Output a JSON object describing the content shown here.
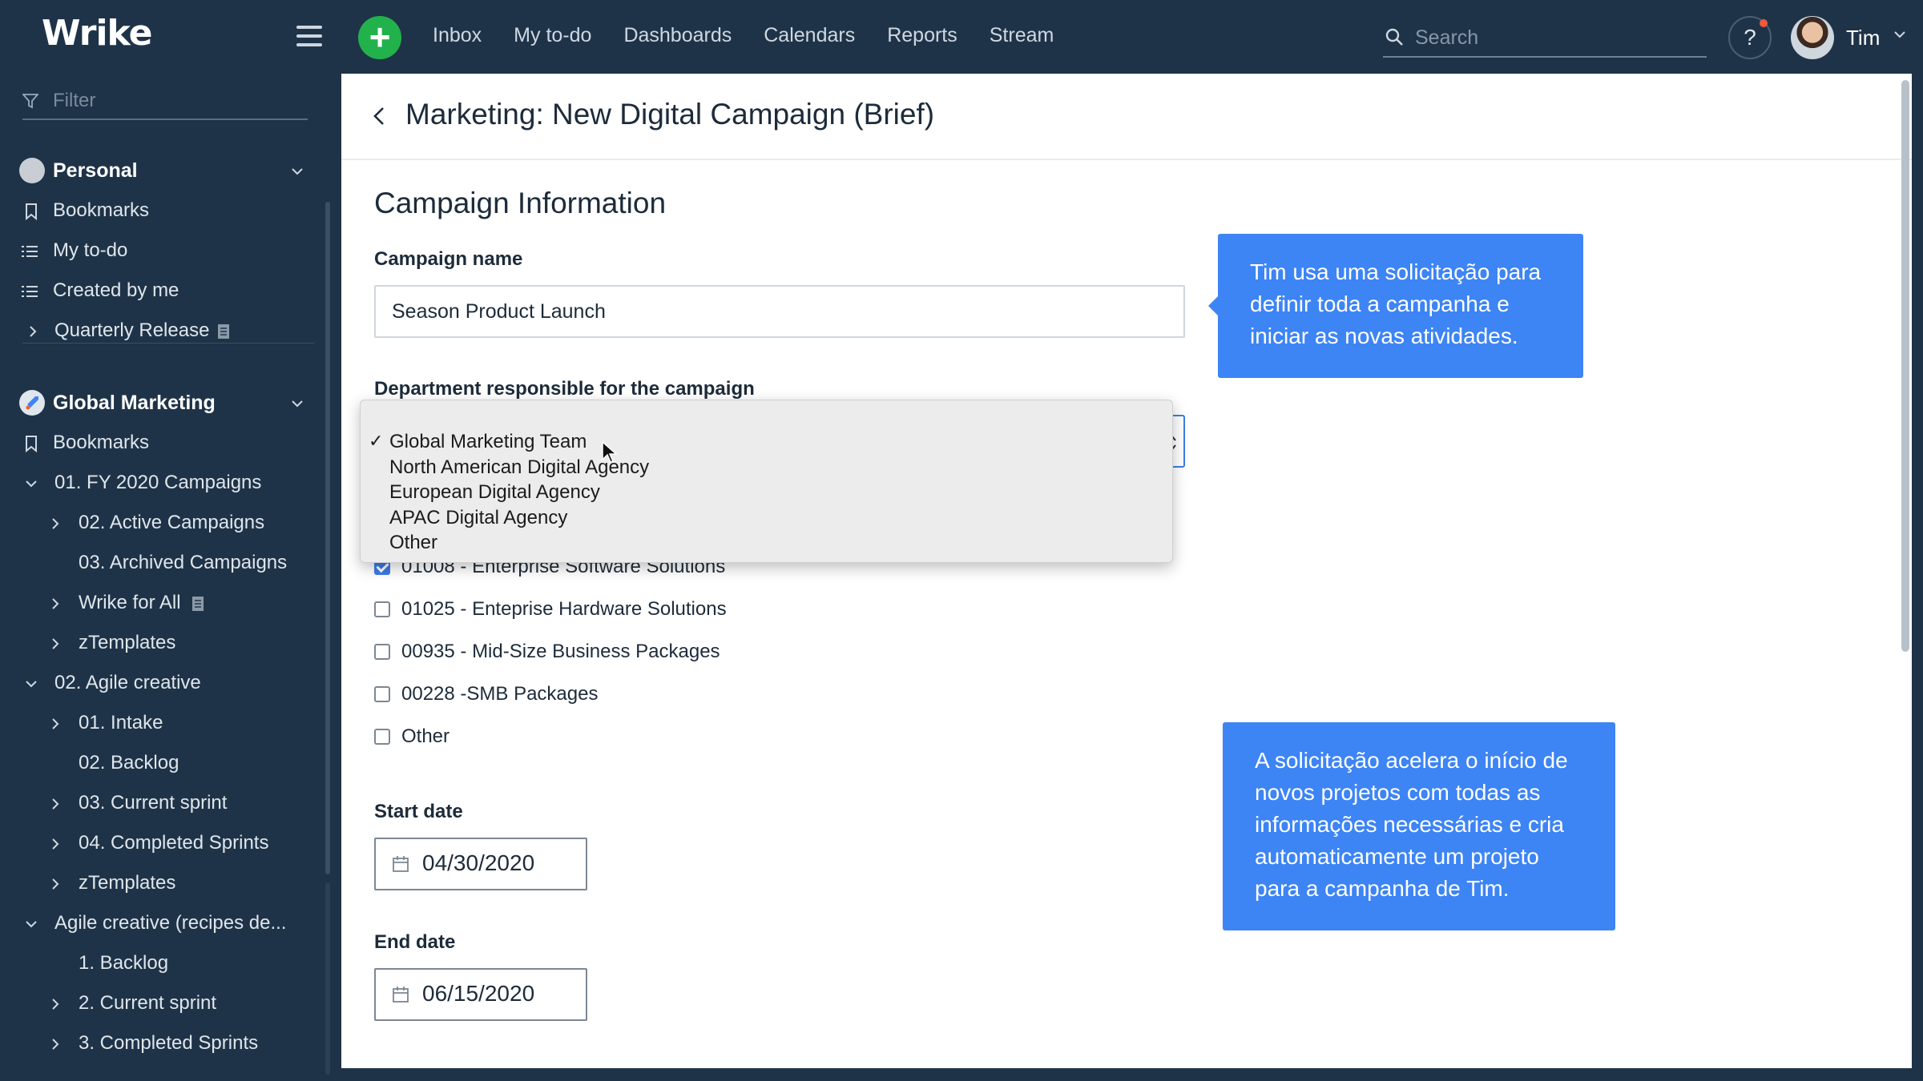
{
  "app": {
    "logo": "Wrike"
  },
  "topbar": {
    "add_label": "+",
    "nav": [
      "Inbox",
      "My to-do",
      "Dashboards",
      "Calendars",
      "Reports",
      "Stream"
    ],
    "search_placeholder": "Search",
    "help_label": "?",
    "user_name": "Tim"
  },
  "sidebar": {
    "filter_placeholder": "Filter",
    "personal": {
      "title": "Personal",
      "items": [
        "Bookmarks",
        "My to-do",
        "Created by me",
        "Quarterly Release"
      ]
    },
    "global": {
      "title": "Global Marketing",
      "items": [
        "Bookmarks",
        "01. FY 2020 Campaigns",
        "02. Active Campaigns",
        "03. Archived Campaigns",
        "Wrike for All",
        "zTemplates",
        "02. Agile creative",
        "01. Intake",
        "02. Backlog",
        "03. Current sprint",
        "04. Completed Sprints",
        "zTemplates",
        "Agile creative (recipes de...",
        "1. Backlog",
        "2. Current sprint",
        "3. Completed Sprints"
      ]
    }
  },
  "page": {
    "title": "Marketing: New Digital Campaign (Brief)",
    "section_title": "Campaign Information",
    "campaign_name_label": "Campaign name",
    "campaign_name_value": "Season Product Launch",
    "department_label": "Department responsible for the campaign",
    "department_options": [
      "Global Marketing Team",
      "North American Digital Agency",
      "European Digital Agency",
      "APAC Digital Agency",
      "Other"
    ],
    "department_selected_mark": "✓",
    "checkboxes": [
      {
        "label": "01008 - Enterprise Software Solutions",
        "checked": true
      },
      {
        "label": "01025 - Enteprise Hardware Solutions",
        "checked": false
      },
      {
        "label": "00935 - Mid-Size Business Packages",
        "checked": false
      },
      {
        "label": "00228 -SMB Packages",
        "checked": false
      },
      {
        "label": "Other",
        "checked": false
      }
    ],
    "start_date_label": "Start date",
    "start_date_value": "04/30/2020",
    "end_date_label": "End date",
    "end_date_value": "06/15/2020"
  },
  "tooltips": {
    "first": "Tim usa uma solicitação para definir toda a campanha e iniciar as novas atividades.",
    "second": "A solicitação acelera o início de novos projetos com todas as informações necessárias e cria automaticamente um projeto para a campanha de Tim."
  },
  "colors": {
    "topbar_bg": "#1f3348",
    "accent_green": "#22b24c",
    "accent_blue": "#3d84f5",
    "notification_dot": "#f15a3a"
  }
}
